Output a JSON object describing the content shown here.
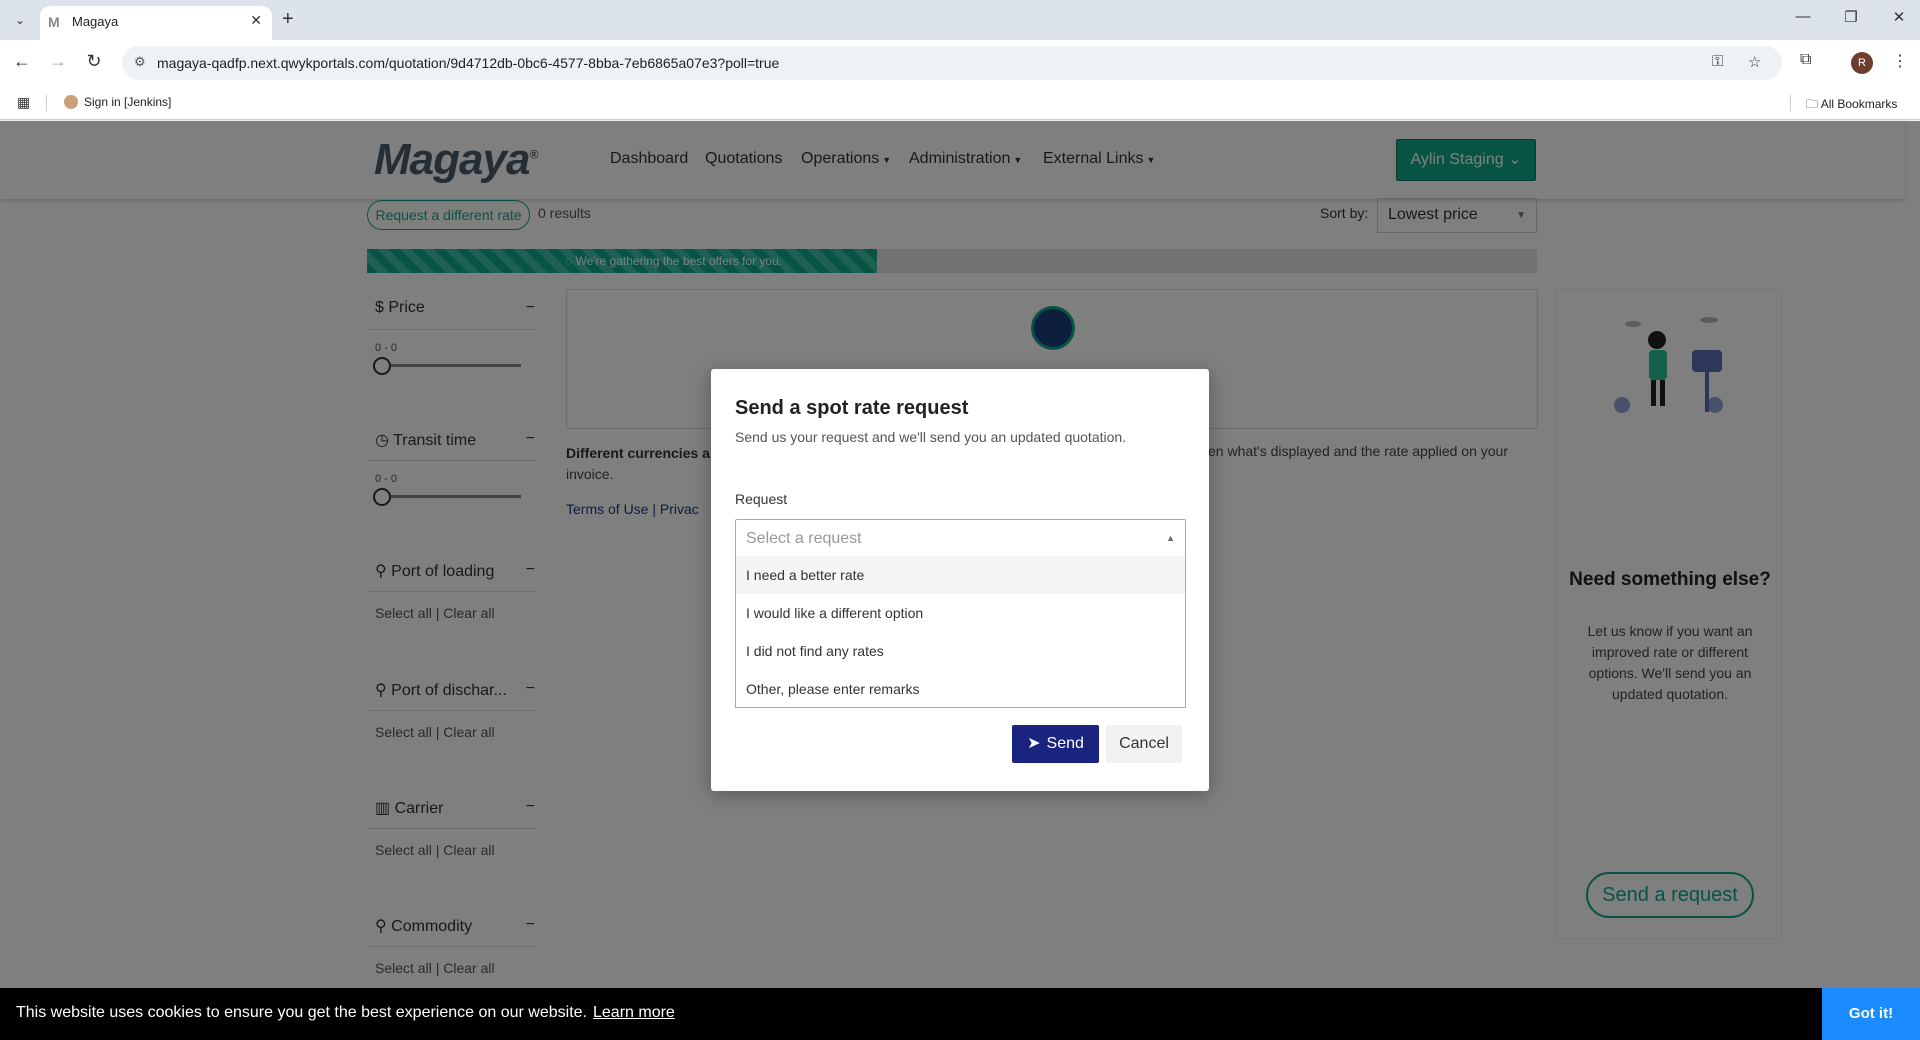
{
  "browser": {
    "tab_title": "Magaya",
    "url": "magaya-qadfp.next.qwykportals.com/quotation/9d4712db-0bc6-4577-8bba-7eb6865a07e3?poll=true",
    "bookmark": "Sign in [Jenkins]",
    "all_bookmarks": "All Bookmarks",
    "profile_initial": "R"
  },
  "nav": {
    "logo": "Magaya",
    "links": [
      "Dashboard",
      "Quotations",
      "Operations",
      "Administration",
      "External Links"
    ],
    "user": "Aylin Staging"
  },
  "results_bar": {
    "request_different": "Request a different rate",
    "count": "0 results",
    "sort_label": "Sort by:",
    "sort_value": "Lowest price"
  },
  "progress": {
    "text": "We're gathering the best offers for you.",
    "fraction": 0.436
  },
  "filters": {
    "price": {
      "label": "Price",
      "range": "0 - 0"
    },
    "transit": {
      "label": "Transit time",
      "range": "0 - 0"
    },
    "pol": {
      "label": "Port of loading"
    },
    "pod": {
      "label": "Port of dischar..."
    },
    "carrier": {
      "label": "Carrier"
    },
    "commodity": {
      "label": "Commodity"
    },
    "select_all": "Select all",
    "clear_all": "Clear all",
    "collapse": "−"
  },
  "note": {
    "bold": "Different currencies ar",
    "right": "en what's displayed and the rate applied on your",
    "line2": "invoice.",
    "terms": "Terms of Use",
    "privacy": "Privac"
  },
  "side": {
    "title": "Need something else?",
    "text": "Let us know if you want an improved rate or different options. We'll send you an updated quotation.",
    "button": "Send a request"
  },
  "modal": {
    "title": "Send a spot rate request",
    "subtitle": "Send us your request and we'll send you an updated quotation.",
    "request_label": "Request",
    "placeholder": "Select a request",
    "options": [
      "I need a better rate",
      "I would like a different option",
      "I did not find any rates",
      "Other, please enter remarks"
    ],
    "send": "Send",
    "cancel": "Cancel"
  },
  "cookie": {
    "text": "This website uses cookies to ensure you get the best experience on our website.",
    "learn_more": "Learn more",
    "button": "Got it!"
  }
}
